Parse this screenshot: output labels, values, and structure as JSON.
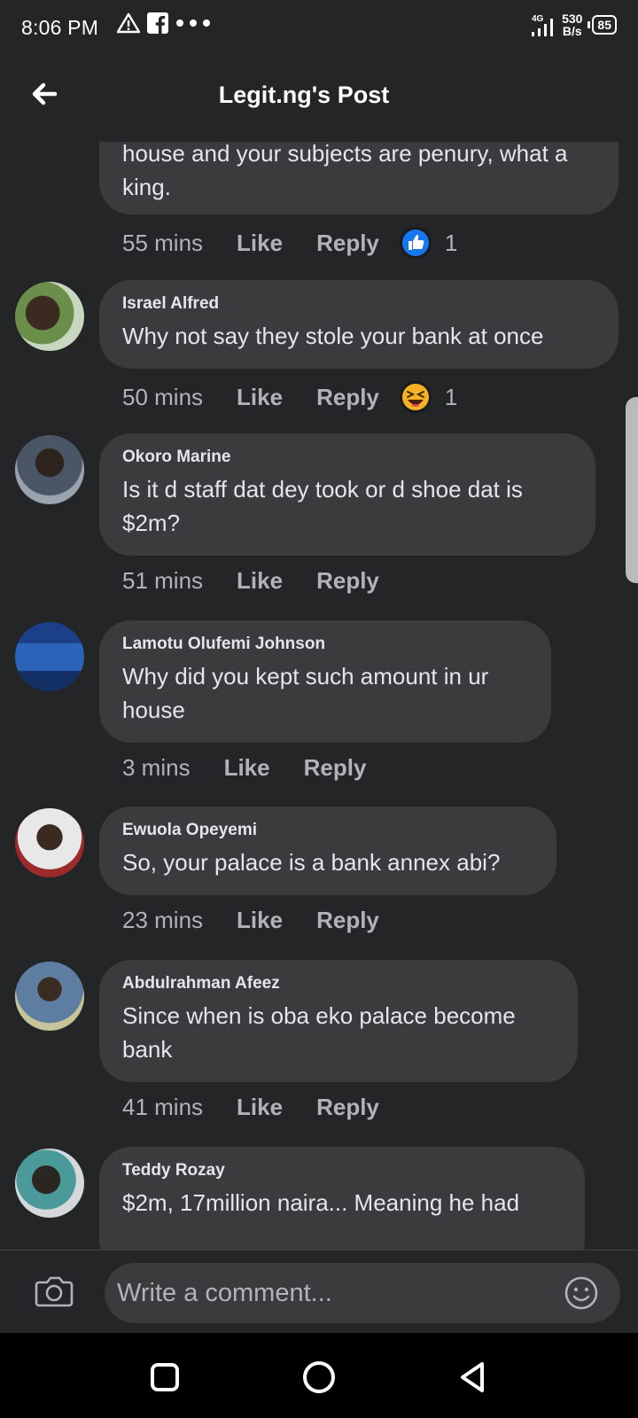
{
  "status_bar": {
    "time": "8:06 PM",
    "network": "4G",
    "speed_value": "530",
    "speed_unit": "B/s",
    "battery": "85"
  },
  "header": {
    "title": "Legit.ng's Post"
  },
  "comments": [
    {
      "name": "",
      "text": "house and your subjects are penury, what a king.",
      "time": "55 mins",
      "like": "Like",
      "reply": "Reply",
      "reaction_icon": "like-reaction-icon",
      "reaction_count": "1"
    },
    {
      "name": "Israel Alfred",
      "text": "Why not say they stole your bank at once",
      "time": "50 mins",
      "like": "Like",
      "reply": "Reply",
      "reaction_icon": "haha-reaction-icon",
      "reaction_count": "1"
    },
    {
      "name": "Okoro Marine",
      "text": "Is it d staff dat dey took or d shoe dat is $2m?",
      "time": "51 mins",
      "like": "Like",
      "reply": "Reply"
    },
    {
      "name": "Lamotu Olufemi Johnson",
      "text": "Why did you kept such amount in ur house",
      "time": "3 mins",
      "like": "Like",
      "reply": "Reply"
    },
    {
      "name": "Ewuola Opeyemi",
      "text": "So, your palace is a bank annex abi?",
      "time": "23 mins",
      "like": "Like",
      "reply": "Reply"
    },
    {
      "name": "Abdulrahman Afeez",
      "text": "Since when is oba eko palace become bank",
      "time": "41 mins",
      "like": "Like",
      "reply": "Reply"
    },
    {
      "name": "Teddy Rozay",
      "text": "$2m, 17million naira... Meaning he had",
      "time": "",
      "like": "",
      "reply": ""
    }
  ],
  "composer": {
    "placeholder": "Write a comment..."
  },
  "colors": {
    "background": "#242526",
    "bubble": "#3a3b3c",
    "text": "#e4e6eb",
    "secondary_text": "#b0b3b8",
    "like_blue": "#1877f2",
    "haha_yellow": "#f7b125"
  }
}
